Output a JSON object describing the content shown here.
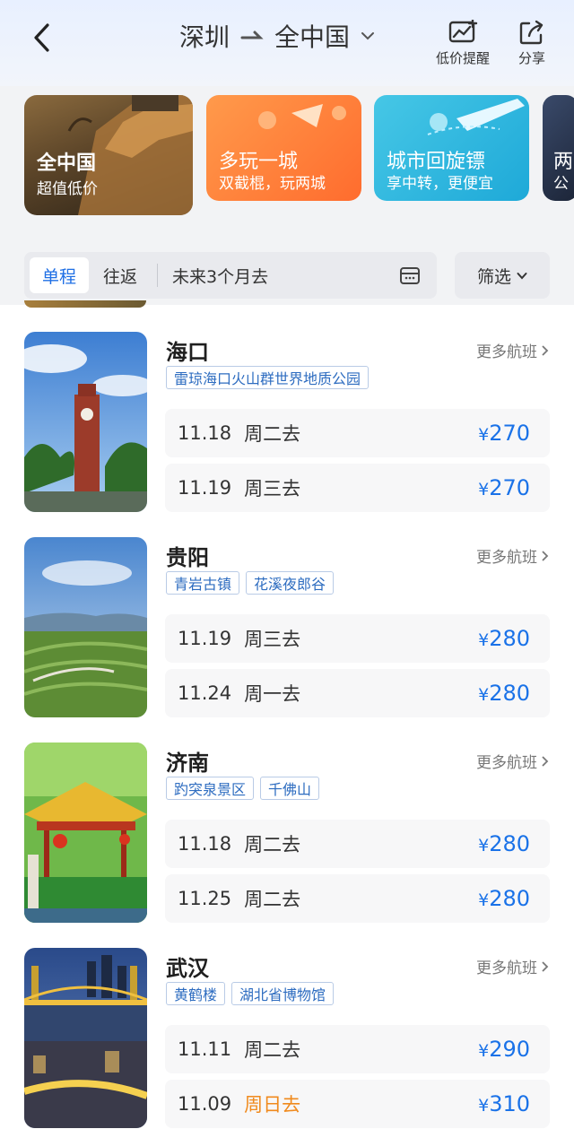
{
  "header": {
    "from_city": "深圳",
    "to_city": "全中国",
    "price_alert_label": "低价提醒",
    "share_label": "分享"
  },
  "banners": [
    {
      "title": "全中国",
      "subtitle": "超值低价"
    },
    {
      "title": "多玩一城",
      "subtitle": "双截棍，玩两城"
    },
    {
      "title": "城市回旋镖",
      "subtitle": "享中转，更便宜"
    },
    {
      "title": "两",
      "subtitle": "公"
    }
  ],
  "tabs": {
    "one_way": "单程",
    "round_trip": "往返",
    "date_range": "未来3个月去",
    "filter": "筛选"
  },
  "destinations": [
    {
      "city": "海口",
      "more": "更多航班",
      "tags": [
        "雷琼海口火山群世界地质公园"
      ],
      "flights": [
        {
          "date": "11.18",
          "weekday": "周二去",
          "yen": "¥",
          "price": "270",
          "weekend": false
        },
        {
          "date": "11.19",
          "weekday": "周三去",
          "yen": "¥",
          "price": "270",
          "weekend": false
        }
      ]
    },
    {
      "city": "贵阳",
      "more": "更多航班",
      "tags": [
        "青岩古镇",
        "花溪夜郎谷"
      ],
      "flights": [
        {
          "date": "11.19",
          "weekday": "周三去",
          "yen": "¥",
          "price": "280",
          "weekend": false
        },
        {
          "date": "11.24",
          "weekday": "周一去",
          "yen": "¥",
          "price": "280",
          "weekend": false
        }
      ]
    },
    {
      "city": "济南",
      "more": "更多航班",
      "tags": [
        "趵突泉景区",
        "千佛山"
      ],
      "flights": [
        {
          "date": "11.18",
          "weekday": "周二去",
          "yen": "¥",
          "price": "280",
          "weekend": false
        },
        {
          "date": "11.25",
          "weekday": "周二去",
          "yen": "¥",
          "price": "280",
          "weekend": false
        }
      ]
    },
    {
      "city": "武汉",
      "more": "更多航班",
      "tags": [
        "黄鹤楼",
        "湖北省博物馆"
      ],
      "flights": [
        {
          "date": "11.11",
          "weekday": "周二去",
          "yen": "¥",
          "price": "290",
          "weekend": false
        },
        {
          "date": "11.09",
          "weekday": "周日去",
          "yen": "¥",
          "price": "310",
          "weekend": true
        }
      ]
    }
  ],
  "colors": {
    "accent": "#1a72e8",
    "weekend": "#f08a1d",
    "tag_text": "#2d6cc0"
  }
}
